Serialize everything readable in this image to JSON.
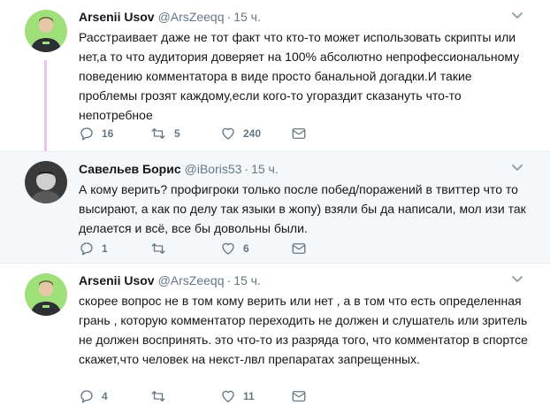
{
  "tweets": [
    {
      "name": "Arsenii Usov",
      "handle": "@ArsZeeqq",
      "dot": "·",
      "time": "15 ч.",
      "text": "Расстраивает даже не тот факт что кто-то может использовать скрипты или нет,а то что аудитория доверяет на 100% абсолютно непрофессиональному поведению комментатора в виде просто банальной догадки.И такие проблемы грозят каждому,если кого-то угораздит сказануть что-то непотребное",
      "replies": "16",
      "retweets": "5",
      "likes": "240"
    },
    {
      "name": "Савельев Борис",
      "handle": "@iBoris53",
      "dot": "·",
      "time": "15 ч.",
      "text": "А кому верить? профигроки только после побед/поражений в твиттер что то высирают, а как по делу так языки в жопу) взяли бы да написали, мол изи так делается и всё, все бы довольны были.",
      "replies": "1",
      "retweets": "",
      "likes": "6"
    },
    {
      "name": "Arsenii Usov",
      "handle": "@ArsZeeqq",
      "dot": "·",
      "time": "15 ч.",
      "text": "скорее вопрос не в том кому верить или нет , а в том что есть определенная грань , которую комментатор переходить не должен и слушатель или зритель не должен воспринять. это что-то из разряда того, что комментатор в спортсе скажет,что человек на некст-лвл препаратах запрещенных.",
      "replies": "4",
      "retweets": "",
      "likes": "11"
    }
  ],
  "colors": {
    "thread_line": "#eac3f5",
    "secondary_text": "#657786",
    "highlight_bg": "#f5f8fa"
  },
  "icons": [
    "reply-icon",
    "retweet-icon",
    "like-icon",
    "direct-message-icon",
    "caret-down-icon"
  ]
}
